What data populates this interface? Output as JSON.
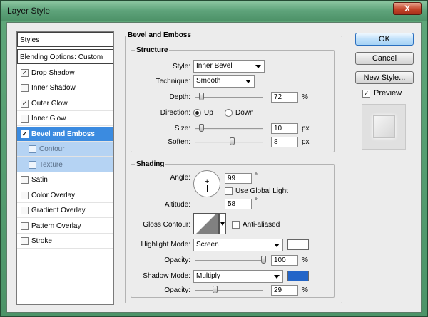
{
  "window": {
    "title": "Layer Style",
    "close_glyph": "X"
  },
  "left_panel": {
    "header": "Styles",
    "items": [
      {
        "label": "Blending Options: Custom",
        "type": "header"
      },
      {
        "label": "Drop Shadow",
        "checked": true
      },
      {
        "label": "Inner Shadow",
        "checked": false
      },
      {
        "label": "Outer Glow",
        "checked": true
      },
      {
        "label": "Inner Glow",
        "checked": false
      },
      {
        "label": "Bevel and Emboss",
        "checked": true,
        "selected": true
      },
      {
        "label": "Contour",
        "checked": false,
        "sub": true
      },
      {
        "label": "Texture",
        "checked": false,
        "sub": true
      },
      {
        "label": "Satin",
        "checked": false
      },
      {
        "label": "Color Overlay",
        "checked": false
      },
      {
        "label": "Gradient Overlay",
        "checked": false
      },
      {
        "label": "Pattern Overlay",
        "checked": false
      },
      {
        "label": "Stroke",
        "checked": false
      }
    ],
    "check_glyph": "✓"
  },
  "bevel": {
    "group_title": "Bevel and Emboss",
    "structure": {
      "title": "Structure",
      "style_label": "Style:",
      "style_value": "Inner Bevel",
      "technique_label": "Technique:",
      "technique_value": "Smooth",
      "depth_label": "Depth:",
      "depth_value": "72",
      "depth_unit": "%",
      "direction_label": "Direction:",
      "direction_up": "Up",
      "direction_down": "Down",
      "size_label": "Size:",
      "size_value": "10",
      "size_unit": "px",
      "soften_label": "Soften:",
      "soften_value": "8",
      "soften_unit": "px"
    },
    "shading": {
      "title": "Shading",
      "angle_label": "Angle:",
      "angle_value": "99",
      "degree": "°",
      "global_light_label": "Use Global Light",
      "altitude_label": "Altitude:",
      "altitude_value": "58",
      "gloss_label": "Gloss Contour:",
      "anti_aliased_label": "Anti-aliased",
      "highlight_label": "Highlight Mode:",
      "highlight_value": "Screen",
      "highlight_color": "#ffffff",
      "opacity_label": "Opacity:",
      "highlight_opacity": "100",
      "percent": "%",
      "shadow_label": "Shadow Mode:",
      "shadow_value": "Multiply",
      "shadow_color": "#2365c8",
      "shadow_opacity": "29",
      "dial_cross": "+"
    }
  },
  "buttons": {
    "ok": "OK",
    "cancel": "Cancel",
    "new_style": "New Style...",
    "preview_label": "Preview"
  }
}
